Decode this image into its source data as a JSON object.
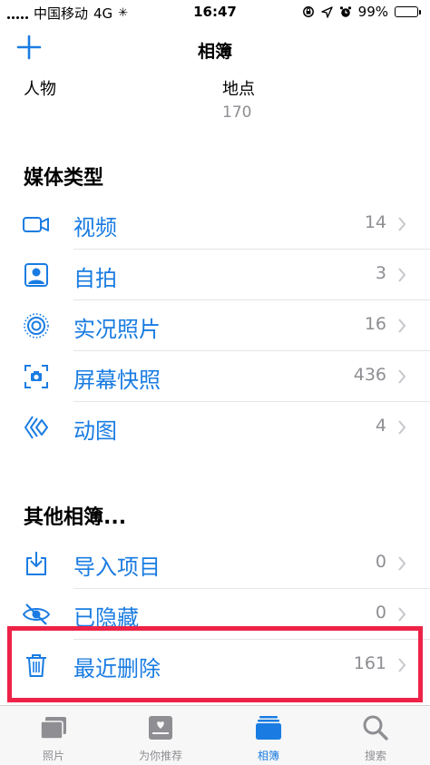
{
  "status_bar": {
    "carrier": "中国移动",
    "network": "4G",
    "time": "16:47",
    "battery_text": "99%",
    "battery_level": 0.99
  },
  "nav": {
    "title": "相簿",
    "add_icon": "plus-icon"
  },
  "people_places": [
    {
      "label": "人物",
      "count": ""
    },
    {
      "label": "地点",
      "count": "170"
    }
  ],
  "media_types": {
    "title": "媒体类型",
    "items": [
      {
        "label": "视频",
        "count": "14",
        "icon": "video-icon"
      },
      {
        "label": "自拍",
        "count": "3",
        "icon": "selfie-icon"
      },
      {
        "label": "实况照片",
        "count": "16",
        "icon": "live-photo-icon"
      },
      {
        "label": "屏幕快照",
        "count": "436",
        "icon": "screenshot-icon"
      },
      {
        "label": "动图",
        "count": "4",
        "icon": "animated-icon"
      }
    ]
  },
  "other_albums": {
    "title": "其他相簿...",
    "items": [
      {
        "label": "导入项目",
        "count": "0",
        "icon": "import-icon"
      },
      {
        "label": "已隐藏",
        "count": "0",
        "icon": "hidden-icon"
      },
      {
        "label": "最近删除",
        "count": "161",
        "icon": "trash-icon"
      }
    ]
  },
  "tab_bar": {
    "tabs": [
      {
        "label": "照片",
        "icon": "photos-icon",
        "active": false
      },
      {
        "label": "为你推荐",
        "icon": "for-you-icon",
        "active": false
      },
      {
        "label": "相簿",
        "icon": "albums-icon",
        "active": true
      },
      {
        "label": "搜索",
        "icon": "search-icon",
        "active": false
      }
    ]
  },
  "colors": {
    "accent": "#1a7ce2",
    "secondary_text": "#8e8e93",
    "highlight": "#ee2247",
    "battery": "#34c759"
  }
}
